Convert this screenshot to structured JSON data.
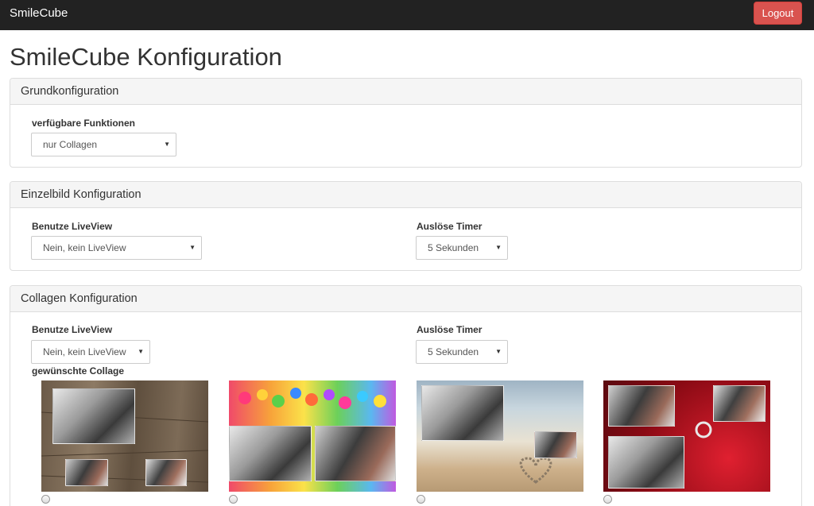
{
  "navbar": {
    "brand": "SmileCube",
    "logout_label": "Logout"
  },
  "page_title": "SmileCube Konfiguration",
  "grund": {
    "heading": "Grundkonfiguration",
    "funktionen_label": "verfügbare Funktionen",
    "funktionen_value": "nur Collagen"
  },
  "einzelbild": {
    "heading": "Einzelbild Konfiguration",
    "liveview_label": "Benutze LiveView",
    "liveview_value": "Nein, kein LiveView",
    "timer_label": "Auslöse Timer",
    "timer_value": "5 Sekunden"
  },
  "collagen": {
    "heading": "Collagen Konfiguration",
    "liveview_label": "Benutze LiveView",
    "liveview_value": "Nein, kein LiveView",
    "timer_label": "Auslöse Timer",
    "timer_value": "5 Sekunden",
    "collage_label": "gewünschte Collage",
    "options": [
      {
        "name": "wood"
      },
      {
        "name": "balloons"
      },
      {
        "name": "beach"
      },
      {
        "name": "roses"
      }
    ]
  }
}
